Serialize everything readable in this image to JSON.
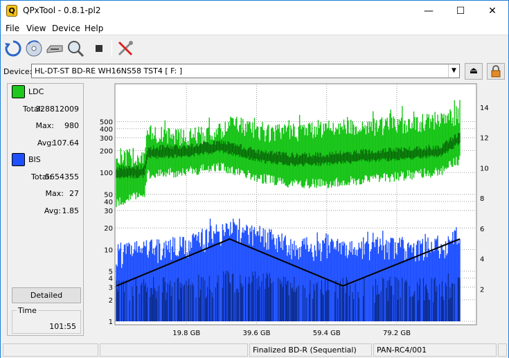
{
  "window": {
    "title": "QPxTool - 0.8.1-pl2",
    "minimize": "—",
    "maximize": "☐",
    "close": "✕"
  },
  "menu": {
    "items": [
      "File",
      "View",
      "Device",
      "Help"
    ]
  },
  "toolbar": {
    "icons": [
      "refresh-icon",
      "disc-scan-icon",
      "drive-icon",
      "magnify-icon",
      "stop-icon",
      "tools-icon"
    ]
  },
  "device": {
    "label": "Device:",
    "value": "HL-DT-ST BD-RE  WH16NS58  TST4 [ F: ]",
    "eject_icon": "eject-icon",
    "lock_icon": "lock-icon"
  },
  "panel": {
    "ldc": {
      "label": "LDC",
      "color": "#1ec81e",
      "total_label": "Total:",
      "total": "328812009",
      "max_label": "Max:",
      "max": "980",
      "avg_label": "Avg:",
      "avg": "107.64"
    },
    "bis": {
      "label": "BIS",
      "color": "#1e50ff",
      "total_label": "Total:",
      "total": "5654355",
      "max_label": "Max:",
      "max": "27",
      "avg_label": "Avg:",
      "avg": "1.85"
    },
    "detailed_label": "Detailed",
    "time_label": "Time",
    "time_value": "101:55"
  },
  "statusbar": {
    "cells": [
      "",
      "",
      "Finalized BD-R (Sequential)",
      "PAN-RC4/001",
      ""
    ]
  },
  "chart_data": [
    {
      "type": "area",
      "name": "LDC",
      "y_scale": "log",
      "y_ticks": [
        "500",
        "400",
        "300",
        "200",
        "100",
        "50",
        "40",
        "30"
      ],
      "x_ticks": [
        "19.8 GB",
        "39.6 GB",
        "59.4 GB",
        "79.2 GB"
      ],
      "x_range_gb": [
        0,
        97
      ],
      "grid": true,
      "color_outer": "#15c415",
      "color_inner": "#086b08",
      "series_env": [
        {
          "x": 0,
          "lo": 40,
          "mid": 100,
          "hi": 200
        },
        {
          "x": 8,
          "lo": 55,
          "mid": 105,
          "hi": 230
        },
        {
          "x": 9,
          "lo": 100,
          "mid": 190,
          "hi": 450
        },
        {
          "x": 20,
          "lo": 110,
          "mid": 200,
          "hi": 400
        },
        {
          "x": 30,
          "lo": 130,
          "mid": 230,
          "hi": 480
        },
        {
          "x": 33,
          "lo": 110,
          "mid": 210,
          "hi": 650
        },
        {
          "x": 40,
          "lo": 90,
          "mid": 170,
          "hi": 450
        },
        {
          "x": 50,
          "lo": 75,
          "mid": 150,
          "hi": 480
        },
        {
          "x": 60,
          "lo": 75,
          "mid": 155,
          "hi": 550
        },
        {
          "x": 70,
          "lo": 85,
          "mid": 170,
          "hi": 550
        },
        {
          "x": 80,
          "lo": 95,
          "mid": 180,
          "hi": 600
        },
        {
          "x": 92,
          "lo": 110,
          "mid": 200,
          "hi": 700
        },
        {
          "x": 97,
          "lo": 160,
          "mid": 300,
          "hi": 800
        }
      ]
    },
    {
      "type": "area",
      "name": "BIS",
      "y_scale": "log",
      "y_ticks": [
        "20",
        "10",
        "5",
        "4",
        "3",
        "2",
        "1"
      ],
      "x_ticks": [
        "19.8 GB",
        "39.6 GB",
        "59.4 GB",
        "79.2 GB"
      ],
      "x_range_gb": [
        0,
        97
      ],
      "color_outer": "#1e50ff",
      "color_inner": "#0a2a8a",
      "series_env": [
        {
          "x": 0,
          "lo": 1,
          "mid": 3,
          "hi": 12
        },
        {
          "x": 20,
          "lo": 1,
          "mid": 3,
          "hi": 16
        },
        {
          "x": 33,
          "lo": 1,
          "mid": 4,
          "hi": 27
        },
        {
          "x": 50,
          "lo": 1,
          "mid": 3,
          "hi": 15
        },
        {
          "x": 70,
          "lo": 1,
          "mid": 3,
          "hi": 15
        },
        {
          "x": 92,
          "lo": 1,
          "mid": 3,
          "hi": 15
        },
        {
          "x": 97,
          "lo": 1,
          "mid": 4,
          "hi": 22
        }
      ]
    },
    {
      "type": "line",
      "name": "speed",
      "right_axis_ticks": [
        "14",
        "12",
        "10",
        "8",
        "6",
        "4",
        "2"
      ],
      "x": [
        0,
        32,
        64,
        97
      ],
      "y": [
        2.2,
        5.3,
        2.2,
        5.3
      ],
      "color": "#000000"
    }
  ]
}
